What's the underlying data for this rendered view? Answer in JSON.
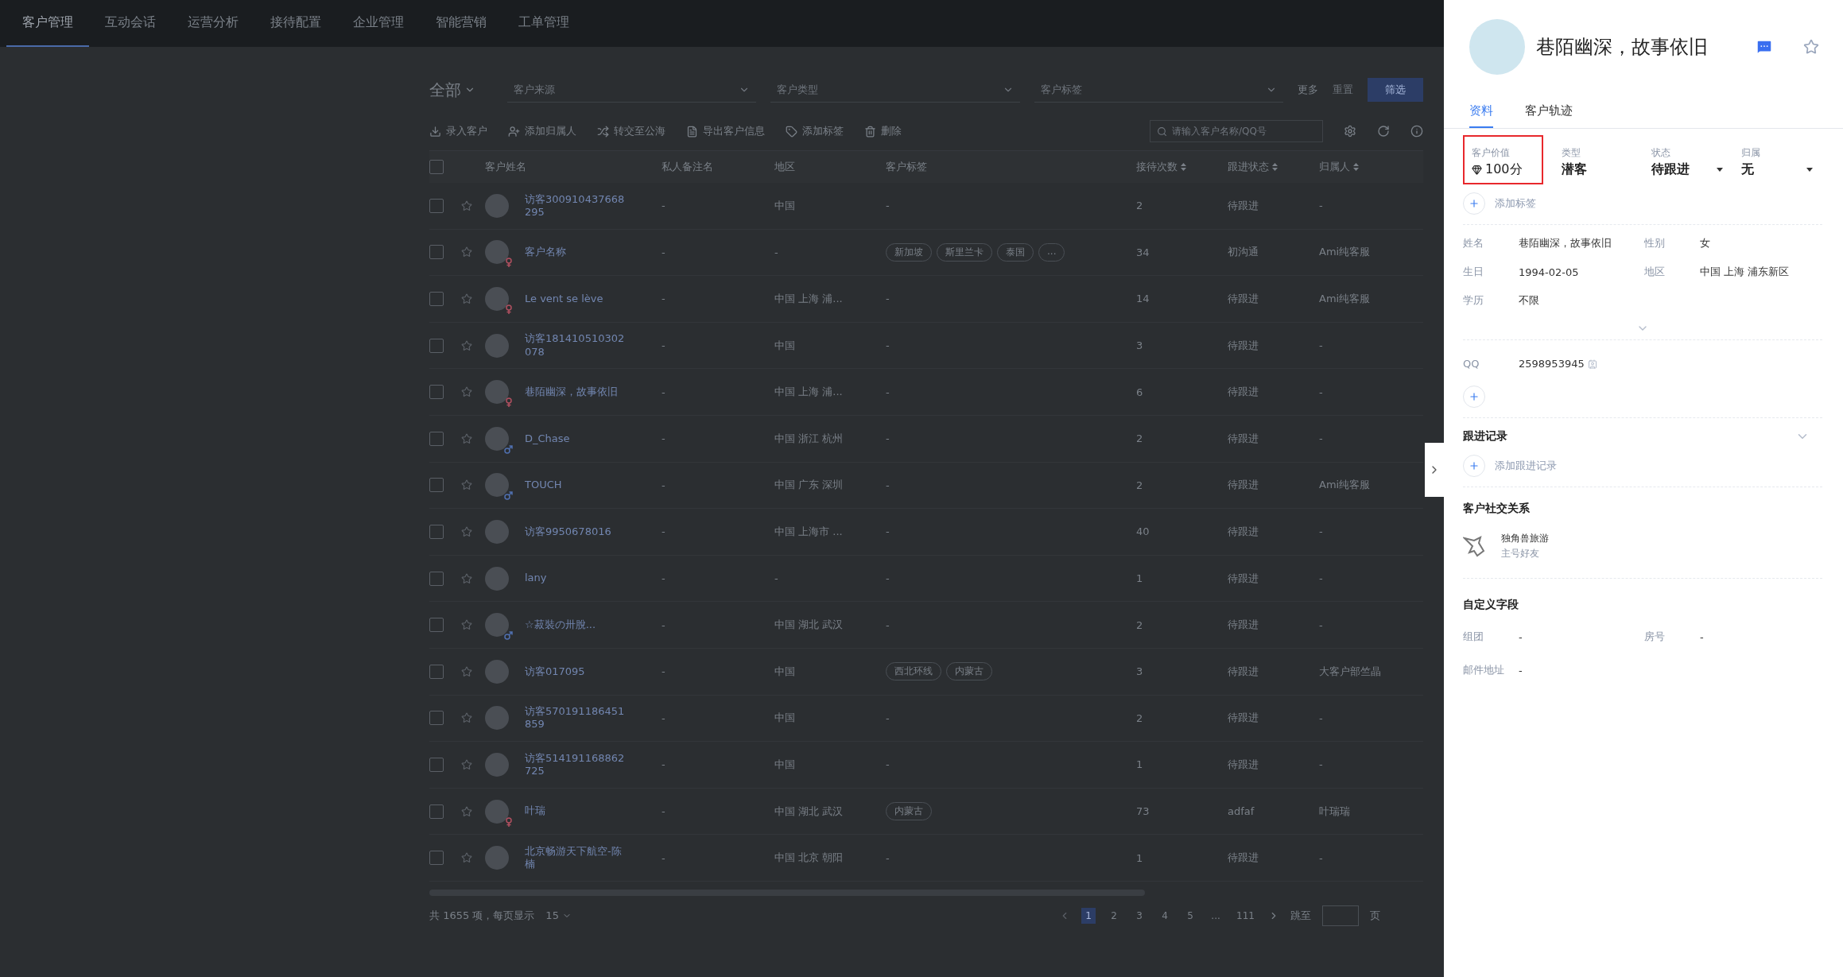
{
  "nav": [
    {
      "label": "客户管理",
      "selected": true
    },
    {
      "label": "互动会话",
      "selected": false
    },
    {
      "label": "运营分析",
      "selected": false
    },
    {
      "label": "接待配置",
      "selected": false
    },
    {
      "label": "企业管理",
      "selected": false
    },
    {
      "label": "智能营销",
      "selected": false
    },
    {
      "label": "工单管理",
      "selected": false
    }
  ],
  "filters": {
    "scope": "全部",
    "selects": [
      {
        "placeholder": "客户来源"
      },
      {
        "placeholder": "客户类型"
      },
      {
        "placeholder": "客户标签"
      }
    ],
    "more": "更多",
    "reset": "重置",
    "submit": "筛选"
  },
  "toolbar": {
    "actions": [
      "录入客户",
      "添加归属人",
      "转交至公海",
      "导出客户信息",
      "添加标签",
      "删除"
    ],
    "search": {
      "placeholder": "请输入客户名称/QQ号"
    }
  },
  "table": {
    "all_checked": false,
    "columns": [
      {
        "label": "客户姓名",
        "sortable": false
      },
      {
        "label": "私人备注名",
        "sortable": false
      },
      {
        "label": "地区",
        "sortable": false
      },
      {
        "label": "客户标签",
        "sortable": false
      },
      {
        "label": "接待次数",
        "sortable": true
      },
      {
        "label": "跟进状态",
        "sortable": true
      },
      {
        "label": "归属人",
        "sortable": true
      }
    ],
    "rows": [
      {
        "checked": false,
        "name": "访客300910437668295",
        "female": false,
        "male": false,
        "remark": "-",
        "region": "中国",
        "tags": [],
        "tag_text": "-",
        "visits": "2",
        "status": "待跟进",
        "owner": "-"
      },
      {
        "checked": false,
        "name": "客户名称",
        "female": true,
        "male": false,
        "remark": "-",
        "region": "-",
        "tags": [
          "新加坡",
          "斯里兰卡",
          "泰国",
          "..."
        ],
        "visits": "34",
        "status": "初沟通",
        "owner": "Ami纯客服"
      },
      {
        "checked": false,
        "name": "Le vent se lève",
        "female": true,
        "male": false,
        "remark": "-",
        "region": "中国 上海 浦...",
        "tags": [],
        "tag_text": "-",
        "visits": "14",
        "status": "待跟进",
        "owner": "Ami纯客服"
      },
      {
        "checked": false,
        "name": "访客181410510302078",
        "female": false,
        "male": false,
        "remark": "-",
        "region": "中国",
        "tags": [],
        "tag_text": "-",
        "visits": "3",
        "status": "待跟进",
        "owner": "-"
      },
      {
        "checked": false,
        "name": "巷陌幽深，故事依旧",
        "female": true,
        "male": false,
        "remark": "-",
        "region": "中国 上海 浦...",
        "tags": [],
        "tag_text": "-",
        "visits": "6",
        "status": "待跟进",
        "owner": "-"
      },
      {
        "checked": false,
        "name": "D_Chase",
        "female": false,
        "male": true,
        "remark": "-",
        "region": "中国 浙江 杭州",
        "tags": [],
        "tag_text": "-",
        "visits": "2",
        "status": "待跟进",
        "owner": "-"
      },
      {
        "checked": false,
        "name": "TOUCH",
        "female": false,
        "male": true,
        "remark": "-",
        "region": "中国 广东 深圳",
        "tags": [],
        "tag_text": "-",
        "visits": "2",
        "status": "待跟进",
        "owner": "Ami纯客服"
      },
      {
        "checked": false,
        "name": "访客9950678016",
        "female": false,
        "male": false,
        "remark": "-",
        "region": "中国 上海市 ...",
        "tags": [],
        "tag_text": "-",
        "visits": "40",
        "status": "待跟进",
        "owner": "-"
      },
      {
        "checked": false,
        "name": "lany",
        "female": false,
        "male": false,
        "remark": "-",
        "region": "-",
        "tags": [],
        "tag_text": "-",
        "visits": "1",
        "status": "待跟进",
        "owner": "-"
      },
      {
        "checked": false,
        "name": "☆菽裝の卅脫...",
        "female": false,
        "male": true,
        "remark": "-",
        "region": "中国 湖北 武汉",
        "tags": [],
        "tag_text": "-",
        "visits": "2",
        "status": "待跟进",
        "owner": "-"
      },
      {
        "checked": false,
        "name": "访客017095",
        "female": false,
        "male": false,
        "remark": "-",
        "region": "中国",
        "tags": [
          "西北环线",
          "内蒙古"
        ],
        "visits": "3",
        "status": "待跟进",
        "owner": "大客户部竺晶"
      },
      {
        "checked": false,
        "name": "访客570191186451859",
        "female": false,
        "male": false,
        "remark": "-",
        "region": "中国",
        "tags": [],
        "tag_text": "-",
        "visits": "2",
        "status": "待跟进",
        "owner": "-"
      },
      {
        "checked": false,
        "name": "访客514191168862725",
        "female": false,
        "male": false,
        "remark": "-",
        "region": "中国",
        "tags": [],
        "tag_text": "-",
        "visits": "1",
        "status": "待跟进",
        "owner": "-"
      },
      {
        "checked": false,
        "name": "叶瑞",
        "female": true,
        "male": false,
        "remark": "-",
        "region": "中国 湖北 武汉",
        "tags": [
          "内蒙古"
        ],
        "visits": "73",
        "status": "adfaf",
        "owner": "叶瑞瑞"
      },
      {
        "checked": false,
        "name": "北京畅游天下航空-陈楠",
        "female": false,
        "male": false,
        "remark": "-",
        "region": "中国 北京 朝阳",
        "tags": [],
        "tag_text": "-",
        "visits": "1",
        "status": "待跟进",
        "owner": "-"
      }
    ]
  },
  "pagination": {
    "total": "共 1655 项，每页显示",
    "page_size": "15",
    "pages": [
      {
        "label": "1",
        "selected": true
      },
      {
        "label": "2",
        "selected": false
      },
      {
        "label": "3",
        "selected": false
      },
      {
        "label": "4",
        "selected": false
      },
      {
        "label": "5",
        "selected": false
      },
      {
        "label": "...",
        "selected": false
      },
      {
        "label": "111",
        "selected": false
      }
    ],
    "jump": "跳至",
    "unit": "页"
  },
  "drawer": {
    "name": "巷陌幽深，故事依旧",
    "tabs": [
      {
        "label": "资料",
        "selected": true
      },
      {
        "label": "客户轨迹",
        "selected": false
      }
    ],
    "summary": [
      {
        "label": "客户价值",
        "value": "100分",
        "kind": "score",
        "highlighted": true
      },
      {
        "label": "类型",
        "value": "潜客",
        "kind": "text",
        "highlighted": false
      },
      {
        "label": "状态",
        "value": "待跟进",
        "kind": "dropdown",
        "highlighted": false
      },
      {
        "label": "归属",
        "value": "无",
        "kind": "dropdown",
        "highlighted": false
      }
    ],
    "add_tag": "添加标签",
    "profile": [
      {
        "label": "姓名",
        "value": "巷陌幽深，故事依旧"
      },
      {
        "label": "性别",
        "value": "女"
      },
      {
        "label": "生日",
        "value": "1994-02-05"
      },
      {
        "label": "地区",
        "value": "中国 上海 浦东新区"
      },
      {
        "label": "学历",
        "value": "不限"
      }
    ],
    "contacts": [
      {
        "label": "QQ",
        "value": "2598953945"
      }
    ],
    "follow_up": {
      "title": "跟进记录",
      "add": "添加跟进记录"
    },
    "social": {
      "title": "客户社交关系",
      "items": [
        {
          "name": "独角兽旅游",
          "relation": "主号好友"
        }
      ]
    },
    "custom": {
      "title": "自定义字段",
      "fields": [
        {
          "label": "组团",
          "value": "-"
        },
        {
          "label": "房号",
          "value": "-"
        },
        {
          "label": "邮件地址",
          "value": "-"
        }
      ]
    }
  }
}
